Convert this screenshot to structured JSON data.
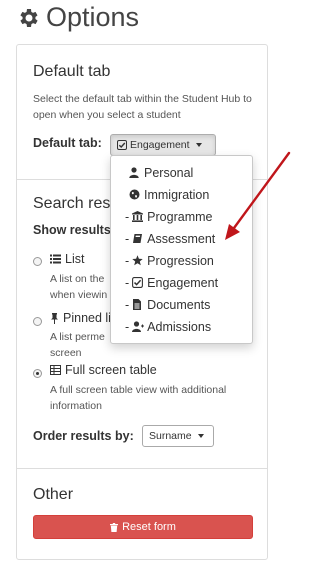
{
  "page": {
    "title": "Options"
  },
  "default_tab": {
    "title": "Default tab",
    "help": "Select the default tab within the Student Hub to open when you select a student",
    "label": "Default tab:",
    "selected": "Engagement",
    "menu": [
      {
        "prefix": "",
        "label": "Personal",
        "icon": "user-icon"
      },
      {
        "prefix": "",
        "label": "Immigration",
        "icon": "globe-icon"
      },
      {
        "prefix": "-",
        "label": "Programme",
        "icon": "institution-icon"
      },
      {
        "prefix": "-",
        "label": "Assessment",
        "icon": "book-icon"
      },
      {
        "prefix": "-",
        "label": "Progression",
        "icon": "star-icon"
      },
      {
        "prefix": "-",
        "label": "Engagement",
        "icon": "check-square-icon"
      },
      {
        "prefix": "-",
        "label": "Documents",
        "icon": "file-icon"
      },
      {
        "prefix": "-",
        "label": "Admissions",
        "icon": "user-plus-icon"
      }
    ]
  },
  "search_results": {
    "title": "Search res",
    "show_label": "Show results",
    "options": [
      {
        "label": "List",
        "desc_lines": [
          "A list on the",
          "when viewin"
        ],
        "checked": false,
        "icon": "list-icon"
      },
      {
        "label": "Pinned li",
        "desc_lines": [
          "A list perme",
          "screen"
        ],
        "checked": false,
        "icon": "pin-icon"
      },
      {
        "label": "Full screen table",
        "desc_lines": [
          "A full screen table view with additional",
          "information"
        ],
        "checked": true,
        "icon": "table-icon"
      }
    ],
    "order_label": "Order results by:",
    "order_value": "Surname"
  },
  "other": {
    "title": "Other",
    "reset_label": "Reset form"
  },
  "colors": {
    "danger": "#d9534f",
    "arrow": "#c0161b"
  }
}
